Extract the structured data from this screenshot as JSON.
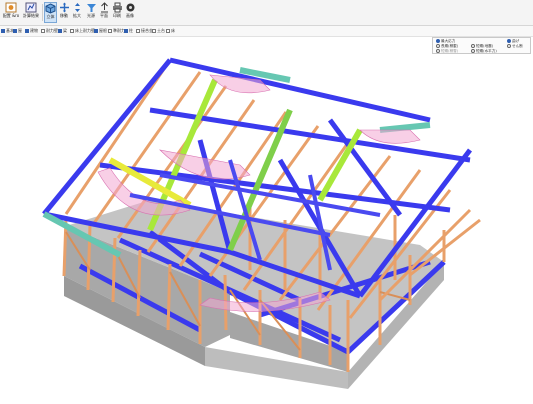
{
  "toolbar": {
    "buttons": [
      {
        "label": "配置 &ro",
        "icon": "layout-icon"
      },
      {
        "label": "計算結果",
        "icon": "result-icon"
      },
      {
        "label": "立体",
        "icon": "cube-icon"
      },
      {
        "label": "移動",
        "icon": "move-icon"
      },
      {
        "label": "拡大",
        "icon": "zoom-icon"
      },
      {
        "label": "光源",
        "icon": "light-icon"
      },
      {
        "label": "平面",
        "icon": "plan-icon"
      },
      {
        "label": "印刷",
        "icon": "print-icon"
      },
      {
        "label": "画像",
        "icon": "image-icon"
      }
    ]
  },
  "options": {
    "items": [
      {
        "label": "基本",
        "checked": true
      },
      {
        "label": "屋",
        "checked": true
      },
      {
        "label": "建物",
        "checked": true
      },
      {
        "label": "耐力壁",
        "checked": false
      },
      {
        "label": "梁",
        "checked": true
      },
      {
        "label": "床上耐力壁",
        "checked": false
      },
      {
        "label": "屋根",
        "checked": true
      },
      {
        "label": "準耐力",
        "checked": false
      },
      {
        "label": "柱",
        "checked": true
      },
      {
        "label": "接合金",
        "checked": false
      },
      {
        "label": "土台",
        "checked": false
      },
      {
        "label": "床",
        "checked": false
      }
    ]
  },
  "panel": {
    "radios": [
      {
        "label": "最大応力",
        "checked": true
      },
      {
        "label": "長期(積載)",
        "checked": false
      },
      {
        "label": "短期(積雪)",
        "checked": false
      },
      {
        "label": "短期(地震)",
        "checked": false
      },
      {
        "label": "短期(水平力)",
        "checked": false
      }
    ],
    "right": [
      {
        "label": "曲げ",
        "checked": true
      },
      {
        "label": "せん断",
        "checked": false
      }
    ]
  }
}
